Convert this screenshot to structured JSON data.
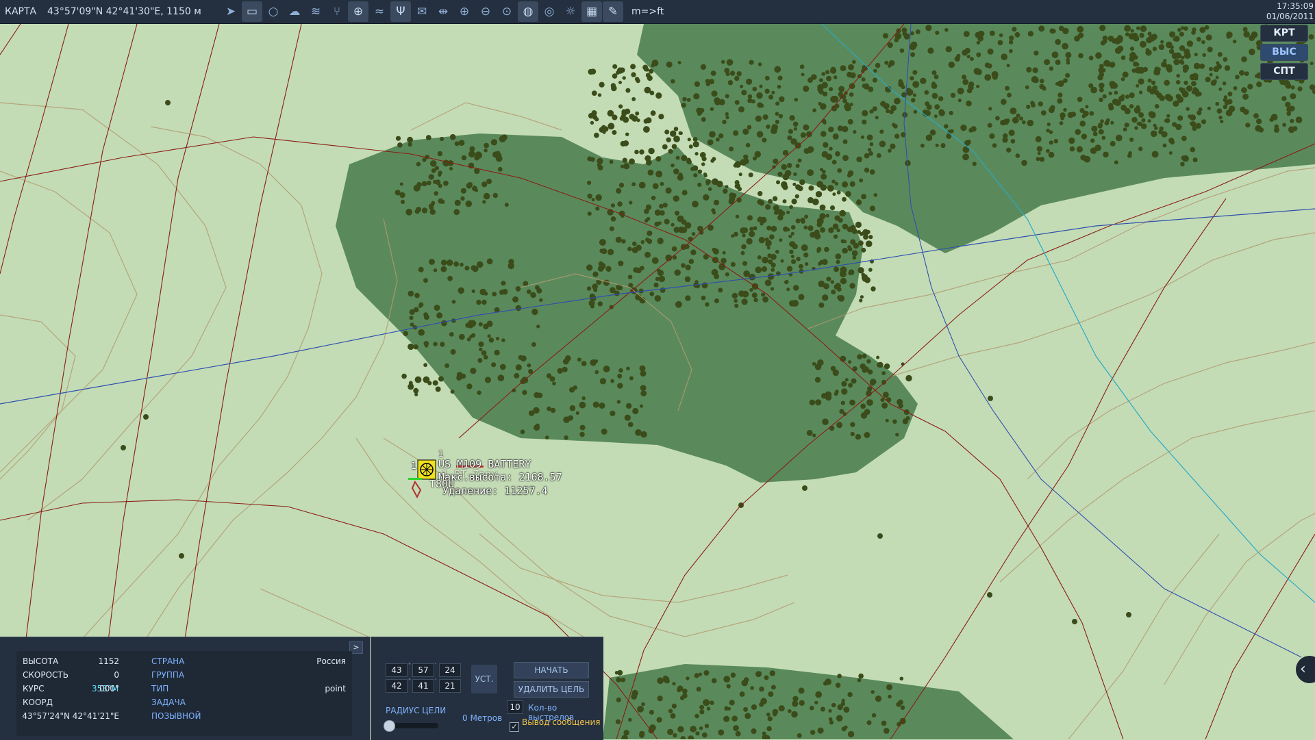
{
  "topbar": {
    "app_title": "КАРТА",
    "coords": "43°57'09\"N 42°41'30\"E, 1150 м",
    "units_toggle": "m=>ft",
    "time": "17:35:09",
    "date": "01/06/2011",
    "icons": [
      "send-icon",
      "ruler-icon",
      "circle-icon",
      "clouds-icon",
      "wind-icon",
      "route-icon",
      "crosshair-icon",
      "signal-icon",
      "antenna-icon",
      "message-icon",
      "split-icon",
      "zoom-in-icon",
      "zoom-out-icon",
      "zoom-fit-icon",
      "globe-icon",
      "target-icon",
      "sun-icon",
      "grid-icon",
      "pen-icon"
    ]
  },
  "side_buttons": [
    "КРТ",
    "ВЫС",
    "СПТ"
  ],
  "map": {
    "unit": {
      "name": "US M109 BATTERY",
      "max_height_line": "Макс.высота: 2168.57",
      "distance_line": "Удаление: 11257.4",
      "overlap_label": "T80U",
      "overlap_label2": "1-5T-Zany",
      "marker_num_a": "1",
      "marker_num_b": "1"
    }
  },
  "info_panel": {
    "expand_label": ">",
    "rows": [
      {
        "label": "ВЫСОТА",
        "value": "1152"
      },
      {
        "label": "СКОРОСТЬ",
        "value": "0"
      },
      {
        "label": "КУРС",
        "value_magnetic": "353°М",
        "value_true": "000°"
      },
      {
        "label": "КООРД",
        "value": "43°57'24\"N 42°41'21\"E"
      }
    ],
    "right_labels": [
      "СТРАНА",
      "ГРУППА",
      "ТИП",
      "ЗАДАЧА",
      "ПОЗЫВНОЙ"
    ],
    "country_value": "Россия",
    "type_value": "point"
  },
  "fire_panel": {
    "lat": [
      "43",
      "57",
      "24"
    ],
    "lon": [
      "42",
      "41",
      "21"
    ],
    "set_button": "УСТ.",
    "start_fire_button": "НАЧАТЬ СТРЕЛЬБУ",
    "delete_target_button": "УДАЛИТЬ ЦЕЛЬ",
    "radius_label": "РАДИУС ЦЕЛИ",
    "radius_value": "0 Метров",
    "radius_fraction": 0,
    "shots_value": "10",
    "shots_label": "Кол-во выстрелов",
    "message_label": "Вывод сообщения",
    "message_checked": true
  },
  "colors": {
    "panel_bg": "#24303f",
    "map_light": "#c3dcb5",
    "forest": "#5a8a5b",
    "trees": "#3b4c1a",
    "contour": "#b39a72",
    "road": "#8a1c14",
    "blue_line": "#2f4fae",
    "cyan_line": "#2aa9c4",
    "accent_blue": "#7fb3ff"
  }
}
